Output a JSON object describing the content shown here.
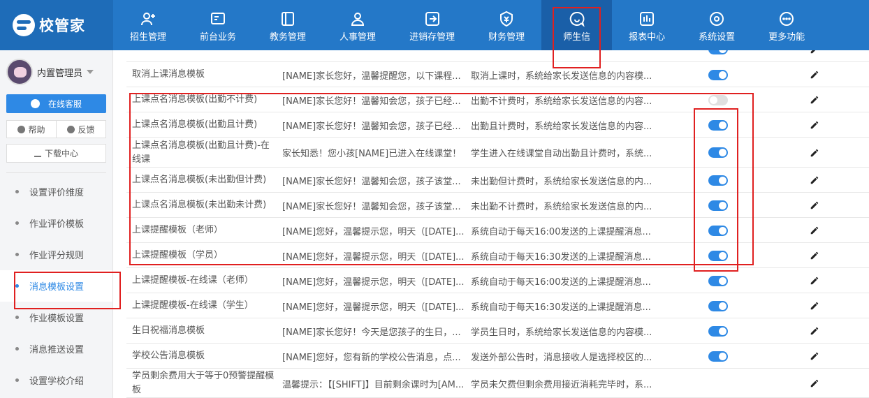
{
  "app": {
    "logo_text": "校管家"
  },
  "nav": [
    {
      "label": "招生管理",
      "icon": "user-plus-icon"
    },
    {
      "label": "前台业务",
      "icon": "monitor-icon"
    },
    {
      "label": "教务管理",
      "icon": "book-icon"
    },
    {
      "label": "人事管理",
      "icon": "person-icon"
    },
    {
      "label": "进销存管理",
      "icon": "box-arrow-icon"
    },
    {
      "label": "财务管理",
      "icon": "yen-shield-icon"
    },
    {
      "label": "师生信",
      "icon": "chat-bubble-icon"
    },
    {
      "label": "报表中心",
      "icon": "bar-chart-icon"
    },
    {
      "label": "系统设置",
      "icon": "gear-icon"
    },
    {
      "label": "更多功能",
      "icon": "more-icon"
    }
  ],
  "sidebar": {
    "user_name": "内置管理员",
    "online_service": "在线客服",
    "help": "帮助",
    "feedback": "反馈",
    "download_center": "下载中心",
    "menu": [
      "设置评价维度",
      "作业评价模板",
      "作业评分规则",
      "消息模板设置",
      "作业模板设置",
      "消息推送设置",
      "设置学校介绍"
    ]
  },
  "table": {
    "rows": [
      {
        "name": "",
        "content": "",
        "desc": "",
        "enabled": true
      },
      {
        "name": "取消上课消息模板",
        "content": "[NAME]家长您好，温馨提醒您，以下课程...",
        "desc": "取消上课时，系统给家长发送信息的内容模...",
        "enabled": true
      },
      {
        "name": "上课点名消息模板(出勤不计费)",
        "content": "[NAME]家长您好！温馨知会您，孩子已经...",
        "desc": "出勤不计费时，系统给家长发送信息的内容...",
        "enabled": false
      },
      {
        "name": "上课点名消息模板(出勤且计费)",
        "content": "[NAME]家长您好！温馨知会您，孩子已经...",
        "desc": "出勤且计费时，系统给家长发送信息的内容...",
        "enabled": true
      },
      {
        "name": "上课点名消息模板(出勤且计费)-在线课",
        "content": "家长知悉！您小孩[NAME]已进入在线课堂！",
        "desc": "学生进入在线课堂自动出勤且计费时，系统...",
        "enabled": true
      },
      {
        "name": "上课点名消息模板(未出勤但计费)",
        "content": "[NAME]家长您好！温馨知会您，孩子该堂...",
        "desc": "未出勤但计费时，系统给家长发送信息的内...",
        "enabled": true
      },
      {
        "name": "上课点名消息模板(未出勤未计费)",
        "content": "[NAME]家长您好！温馨知会您，孩子该堂...",
        "desc": "未出勤不计费时，系统给家长发送信息的内...",
        "enabled": true
      },
      {
        "name": "上课提醒模板（老师）",
        "content": "[NAME]您好，温馨提示您，明天（[DATE]...",
        "desc": "系统自动于每天16:00发送的上课提醒消息...",
        "enabled": true
      },
      {
        "name": "上课提醒模板（学员）",
        "content": "[NAME]您好，温馨提示您，明天（[DATE]...",
        "desc": "系统自动于每天16:30发送的上课提醒消息...",
        "enabled": true
      },
      {
        "name": "上课提醒模板-在线课（老师）",
        "content": "[NAME]您好，温馨提示您，明天（[DATE]...",
        "desc": "系统自动于每天16:00发送的上课提醒消息...",
        "enabled": true
      },
      {
        "name": "上课提醒模板-在线课（学生）",
        "content": "[NAME]您好，温馨提示您，明天（[DATE]...",
        "desc": "系统自动于每天16:30发送的上课提醒消息...",
        "enabled": true
      },
      {
        "name": "生日祝福消息模板",
        "content": "[NAME]家长您好！今天是您孩子的生日，...",
        "desc": "学员生日时，系统给家长发送信息的内容模...",
        "enabled": true
      },
      {
        "name": "学校公告消息模板",
        "content": "[NAME]您好，您有新的学校公告消息，点...",
        "desc": "发送外部公告时，消息接收人是选择校区的...",
        "enabled": true
      },
      {
        "name": "学员剩余费用大于等于0预警提醒模板",
        "content": "温馨提示：【[SHIFT]】目前剩余课时为[AM...",
        "desc": "学员未欠费但剩余费用接近消耗完毕时，系...",
        "enabled": null
      }
    ]
  }
}
